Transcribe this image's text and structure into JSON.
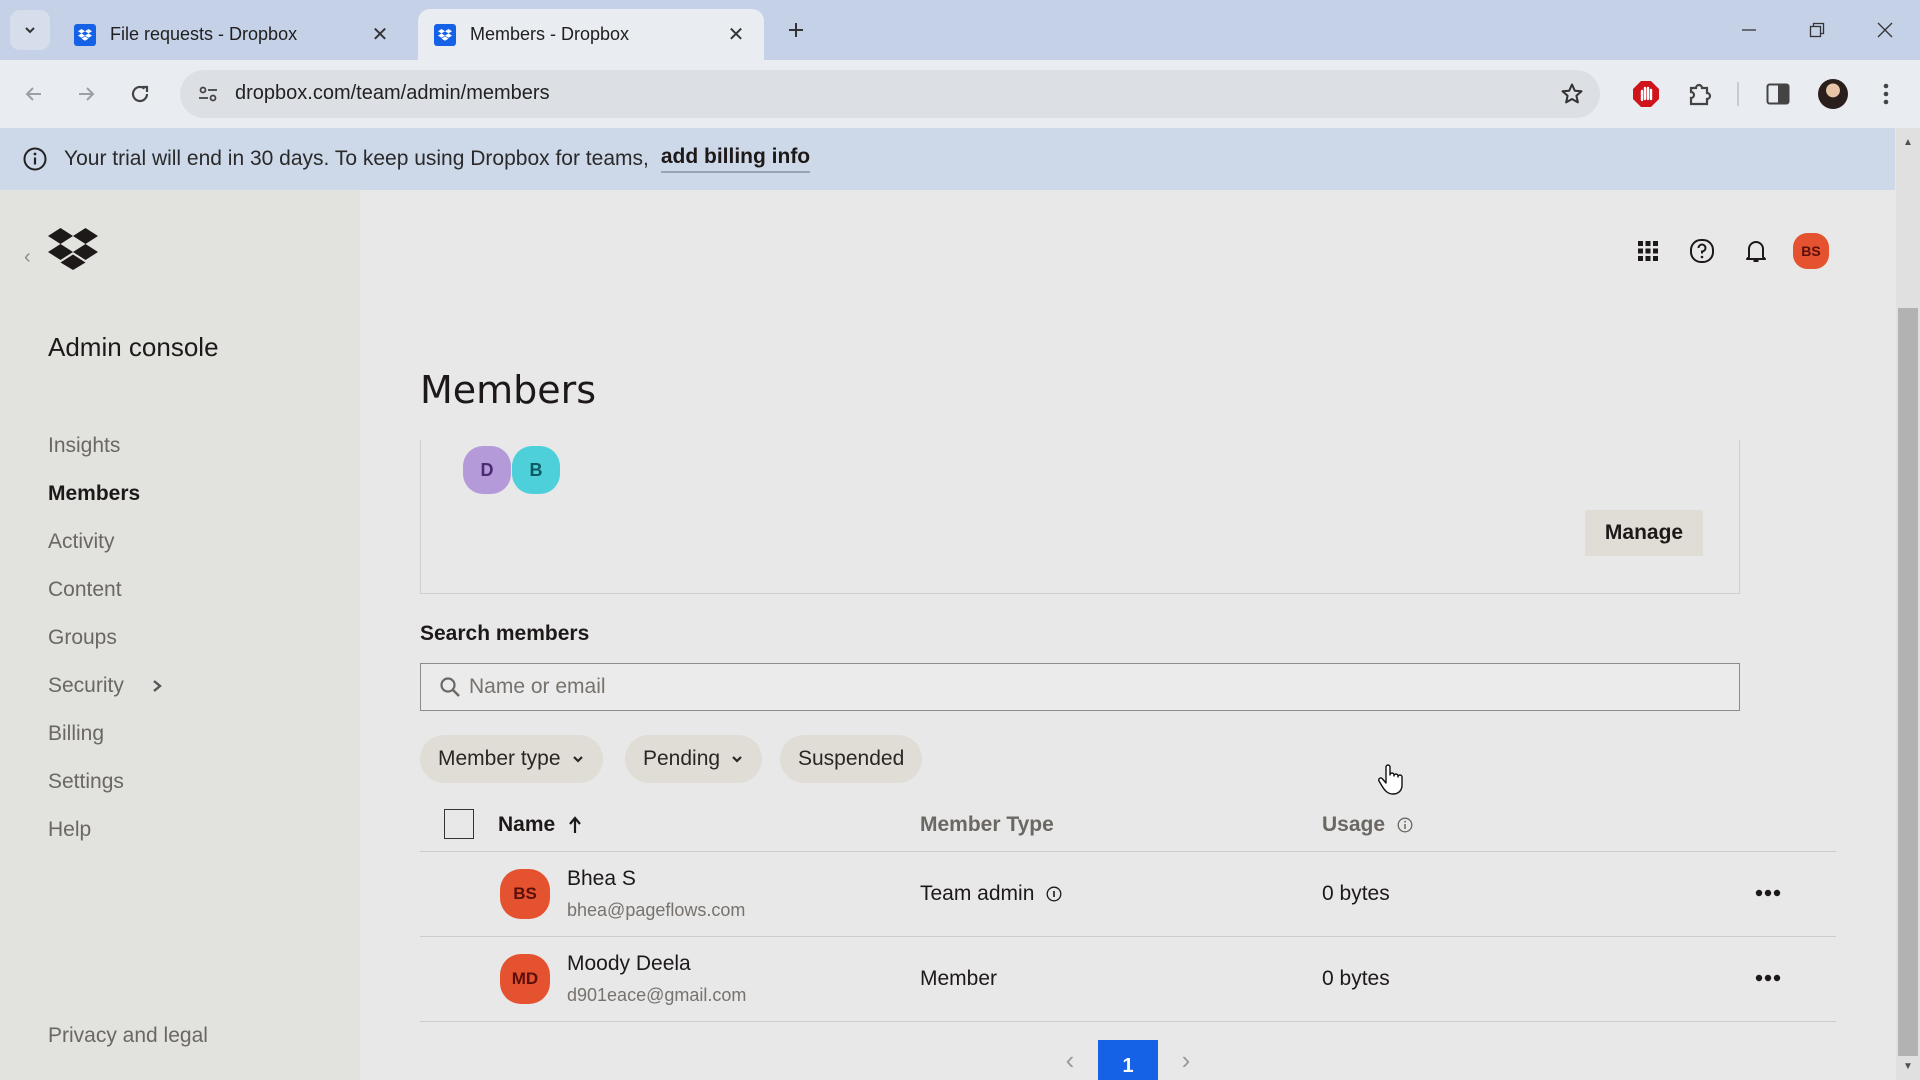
{
  "browser": {
    "tabs": [
      {
        "title": "File requests - Dropbox",
        "active": false
      },
      {
        "title": "Members - Dropbox",
        "active": true
      }
    ],
    "new_tab_icon": "plus-icon",
    "url": "dropbox.com/team/admin/members",
    "window_controls": [
      "minimize",
      "restore",
      "close"
    ]
  },
  "banner": {
    "message": "Your trial will end in 30 days. To keep using Dropbox for teams,",
    "link": "add billing info"
  },
  "sidebar": {
    "title": "Admin console",
    "items": [
      {
        "label": "Insights",
        "active": false
      },
      {
        "label": "Members",
        "active": true
      },
      {
        "label": "Activity",
        "active": false
      },
      {
        "label": "Content",
        "active": false
      },
      {
        "label": "Groups",
        "active": false
      },
      {
        "label": "Security",
        "active": false,
        "has_submenu": true
      },
      {
        "label": "Billing",
        "active": false
      },
      {
        "label": "Settings",
        "active": false
      },
      {
        "label": "Help",
        "active": false
      }
    ],
    "footer_link": "Privacy and legal"
  },
  "header": {
    "icons": [
      "app-grid-icon",
      "help-icon",
      "bell-icon"
    ],
    "user_initials": "BS"
  },
  "main": {
    "title": "Members",
    "card": {
      "avatars": [
        {
          "initial": "D",
          "color": "#b49ad8"
        },
        {
          "initial": "B",
          "color": "#4ed0da"
        }
      ],
      "manage_label": "Manage"
    },
    "search": {
      "label": "Search members",
      "placeholder": "Name or email",
      "value": ""
    },
    "filters": [
      {
        "label": "Member type",
        "dropdown": true
      },
      {
        "label": "Pending",
        "dropdown": true
      },
      {
        "label": "Suspended",
        "dropdown": false
      }
    ],
    "table": {
      "columns": {
        "name": "Name",
        "member_type": "Member Type",
        "usage": "Usage"
      },
      "sort": {
        "column": "Name",
        "direction": "ascending"
      },
      "rows": [
        {
          "initials": "BS",
          "name": "Bhea S",
          "email": "bhea@pageflows.com",
          "member_type": "Team admin",
          "type_info": true,
          "usage": "0 bytes"
        },
        {
          "initials": "MD",
          "name": "Moody Deela",
          "email": "d901eace@gmail.com",
          "member_type": "Member",
          "type_info": false,
          "usage": "0 bytes"
        }
      ]
    },
    "pagination": {
      "current_page": "1"
    }
  },
  "colors": {
    "accent": "#1662e6",
    "avatar_orange": "#e5522f",
    "sidebar_bg": "#e2e2df",
    "main_bg": "#e8e8e8",
    "banner_bg": "#cdd8e8"
  }
}
